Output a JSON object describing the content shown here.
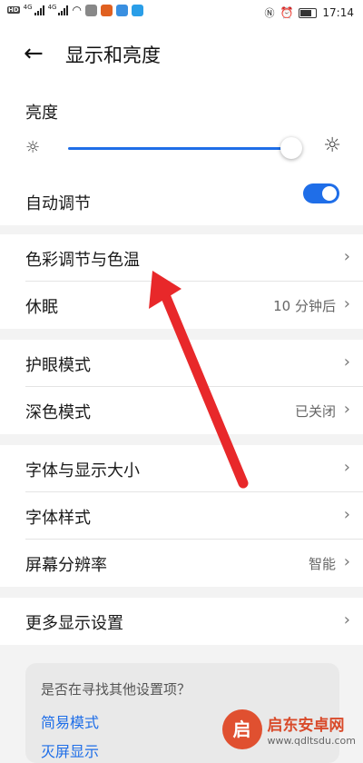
{
  "status_bar": {
    "network_labels": [
      "4G",
      "4G"
    ],
    "time": "17:14"
  },
  "header": {
    "back_icon": "←",
    "title": "显示和亮度"
  },
  "brightness": {
    "label": "亮度",
    "level": 0.98,
    "auto_label": "自动调节",
    "auto_enabled": true
  },
  "groups": [
    {
      "rows": [
        {
          "label": "色彩调节与色温",
          "value": ""
        },
        {
          "label": "休眠",
          "value": "10 分钟后"
        }
      ]
    },
    {
      "rows": [
        {
          "label": "护眼模式",
          "value": ""
        },
        {
          "label": "深色模式",
          "value": "已关闭"
        }
      ]
    },
    {
      "rows": [
        {
          "label": "字体与显示大小",
          "value": ""
        },
        {
          "label": "字体样式",
          "value": ""
        },
        {
          "label": "屏幕分辨率",
          "value": "智能"
        }
      ]
    },
    {
      "rows": [
        {
          "label": "更多显示设置",
          "value": ""
        }
      ]
    }
  ],
  "chevron": "›",
  "suggestion": {
    "question": "是否在寻找其他设置项？",
    "links": [
      "简易模式",
      "灭屏显示"
    ]
  },
  "watermark": {
    "logo": "启",
    "name": "启东安卓网",
    "url": "www.qdltsdu.com"
  },
  "colors": {
    "accent": "#1f6ee8",
    "arrow": "#e8282a"
  }
}
